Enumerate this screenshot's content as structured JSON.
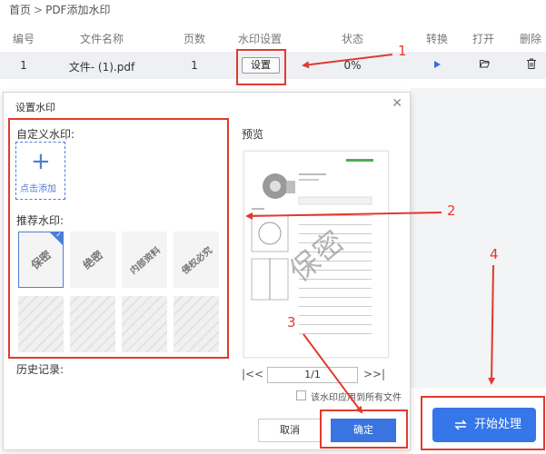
{
  "breadcrumb": {
    "home": "首页",
    "separator": ">",
    "current": "PDF添加水印"
  },
  "table": {
    "headers": [
      "编号",
      "文件名称",
      "页数",
      "水印设置",
      "状态",
      "转换",
      "打开",
      "删除"
    ],
    "row": {
      "index": "1",
      "filename": "文件- (1).pdf",
      "pages": "1",
      "setting_button": "设置",
      "status": "0%"
    }
  },
  "dialog": {
    "title": "设置水印",
    "custom_label": "自定义水印:",
    "add_label": "点击添加",
    "recommended_label": "推荐水印:",
    "recommended": [
      "保密",
      "绝密",
      "内部资料",
      "侵权必究"
    ],
    "history_label": "历史记录:",
    "preview_label": "预览",
    "preview_watermark": "保密",
    "pager": {
      "first": "|<",
      "prev": "<",
      "page": "1/1",
      "next": ">",
      "last": ">|"
    },
    "apply_all": "该水印应用到所有文件",
    "cancel": "取消",
    "ok": "确定"
  },
  "start_button": "开始处理",
  "annotations": [
    "1",
    "2",
    "3",
    "4"
  ],
  "colors": {
    "accent": "#3a74e0",
    "annotation": "#e03a2e"
  }
}
